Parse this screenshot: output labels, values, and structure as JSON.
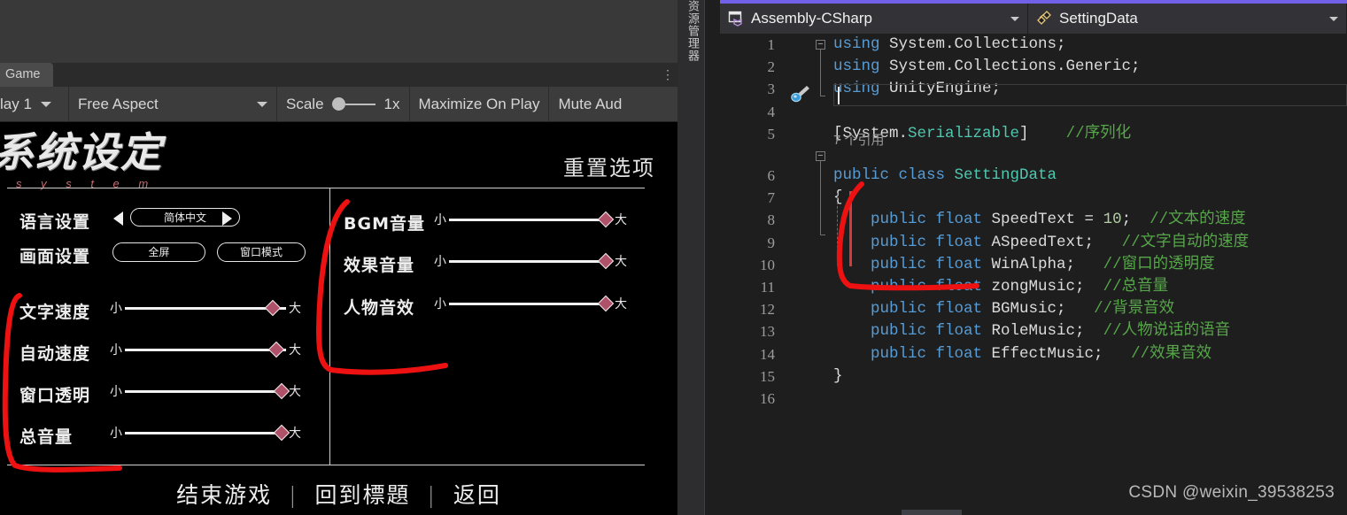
{
  "unity": {
    "tab_label": "Game",
    "tab_overflow_icon": "more-options-icon",
    "toolbar": {
      "display_label": "lay 1",
      "aspect_label": "Free Aspect",
      "scale_label": "Scale",
      "scale_value": "1x",
      "maximize_label": "Maximize On Play",
      "mute_label": "Mute Aud"
    },
    "game": {
      "title_main": "系统设定",
      "title_sub": "s y s t e m",
      "reset_label": "重置选项",
      "left_options": [
        {
          "label": "语言设置",
          "type": "stepper",
          "value": "简体中文"
        },
        {
          "label": "画面设置",
          "type": "buttons",
          "buttons": [
            "全屏",
            "窗口模式"
          ]
        },
        {
          "label": "文字速度",
          "type": "slider",
          "min_label": "小",
          "max_label": "大",
          "value": 92
        },
        {
          "label": "自动速度",
          "type": "slider",
          "min_label": "小",
          "max_label": "大",
          "value": 94
        },
        {
          "label": "窗口透明",
          "type": "slider",
          "min_label": "小",
          "max_label": "大",
          "value": 97
        },
        {
          "label": "总音量",
          "type": "slider",
          "min_label": "小",
          "max_label": "大",
          "value": 97
        }
      ],
      "right_options": [
        {
          "label": "BGM音量",
          "min_label": "小",
          "max_label": "大",
          "value": 96
        },
        {
          "label": "效果音量",
          "min_label": "小",
          "max_label": "大",
          "value": 96
        },
        {
          "label": "人物音效",
          "min_label": "小",
          "max_label": "大",
          "value": 96
        }
      ],
      "footer": [
        "结束游戏",
        "回到標題",
        "返回"
      ],
      "footer_separator": "|"
    }
  },
  "vs": {
    "side_tab_label": "资源管理器",
    "project_combo": {
      "icon": "cs-project-icon",
      "label": "Assembly-CSharp"
    },
    "type_combo": {
      "icon": "class-icon",
      "label": "SettingData"
    },
    "accent_color": "#7160e8",
    "codelens": "7 个引用",
    "lines": [
      {
        "n": "1",
        "tokens": [
          {
            "t": "using ",
            "c": "kw"
          },
          {
            "t": "System.Collections;",
            "c": "pln"
          }
        ]
      },
      {
        "n": "2",
        "tokens": [
          {
            "t": "using ",
            "c": "kw"
          },
          {
            "t": "System.Collections.Generic;",
            "c": "pln"
          }
        ]
      },
      {
        "n": "3",
        "tokens": [
          {
            "t": "using ",
            "c": "kw"
          },
          {
            "t": "UnityEngine;",
            "c": "pln"
          }
        ]
      },
      {
        "n": "4",
        "tokens": []
      },
      {
        "n": "5",
        "tokens": [
          {
            "t": "[System.",
            "c": "pln"
          },
          {
            "t": "Serializable",
            "c": "typ"
          },
          {
            "t": "]    ",
            "c": "pln"
          },
          {
            "t": "//序列化",
            "c": "cmt"
          }
        ]
      },
      {
        "n": "6",
        "tokens": [
          {
            "t": "public class ",
            "c": "kw"
          },
          {
            "t": "SettingData",
            "c": "typ"
          }
        ]
      },
      {
        "n": "7",
        "tokens": [
          {
            "t": "{",
            "c": "pln"
          }
        ]
      },
      {
        "n": "8",
        "tokens": [
          {
            "t": "    public float ",
            "c": "kw"
          },
          {
            "t": "SpeedText = ",
            "c": "pln"
          },
          {
            "t": "10",
            "c": "num"
          },
          {
            "t": ";  ",
            "c": "pln"
          },
          {
            "t": "//文本的速度",
            "c": "cmt"
          }
        ]
      },
      {
        "n": "9",
        "tokens": [
          {
            "t": "    public float ",
            "c": "kw"
          },
          {
            "t": "ASpeedText;   ",
            "c": "pln"
          },
          {
            "t": "//文字自动的速度",
            "c": "cmt"
          }
        ]
      },
      {
        "n": "10",
        "tokens": [
          {
            "t": "    public float ",
            "c": "kw"
          },
          {
            "t": "WinAlpha;   ",
            "c": "pln"
          },
          {
            "t": "//窗口的透明度",
            "c": "cmt"
          }
        ]
      },
      {
        "n": "11",
        "tokens": [
          {
            "t": "    public float ",
            "c": "kw"
          },
          {
            "t": "zongMusic;  ",
            "c": "pln"
          },
          {
            "t": "//总音量",
            "c": "cmt"
          }
        ]
      },
      {
        "n": "12",
        "tokens": [
          {
            "t": "    public float ",
            "c": "kw"
          },
          {
            "t": "BGMusic;   ",
            "c": "pln"
          },
          {
            "t": "//背景音效",
            "c": "cmt"
          }
        ]
      },
      {
        "n": "13",
        "tokens": [
          {
            "t": "    public float ",
            "c": "kw"
          },
          {
            "t": "RoleMusic;  ",
            "c": "pln"
          },
          {
            "t": "//人物说话的语音",
            "c": "cmt"
          }
        ]
      },
      {
        "n": "14",
        "tokens": [
          {
            "t": "    public float ",
            "c": "kw"
          },
          {
            "t": "EffectMusic;   ",
            "c": "pln"
          },
          {
            "t": "//效果音效",
            "c": "cmt"
          }
        ]
      },
      {
        "n": "15",
        "tokens": [
          {
            "t": "}",
            "c": "pln"
          }
        ]
      },
      {
        "n": "16",
        "tokens": []
      }
    ]
  },
  "watermark": "CSDN @weixin_39538253",
  "annotation_color": "#ee1111"
}
